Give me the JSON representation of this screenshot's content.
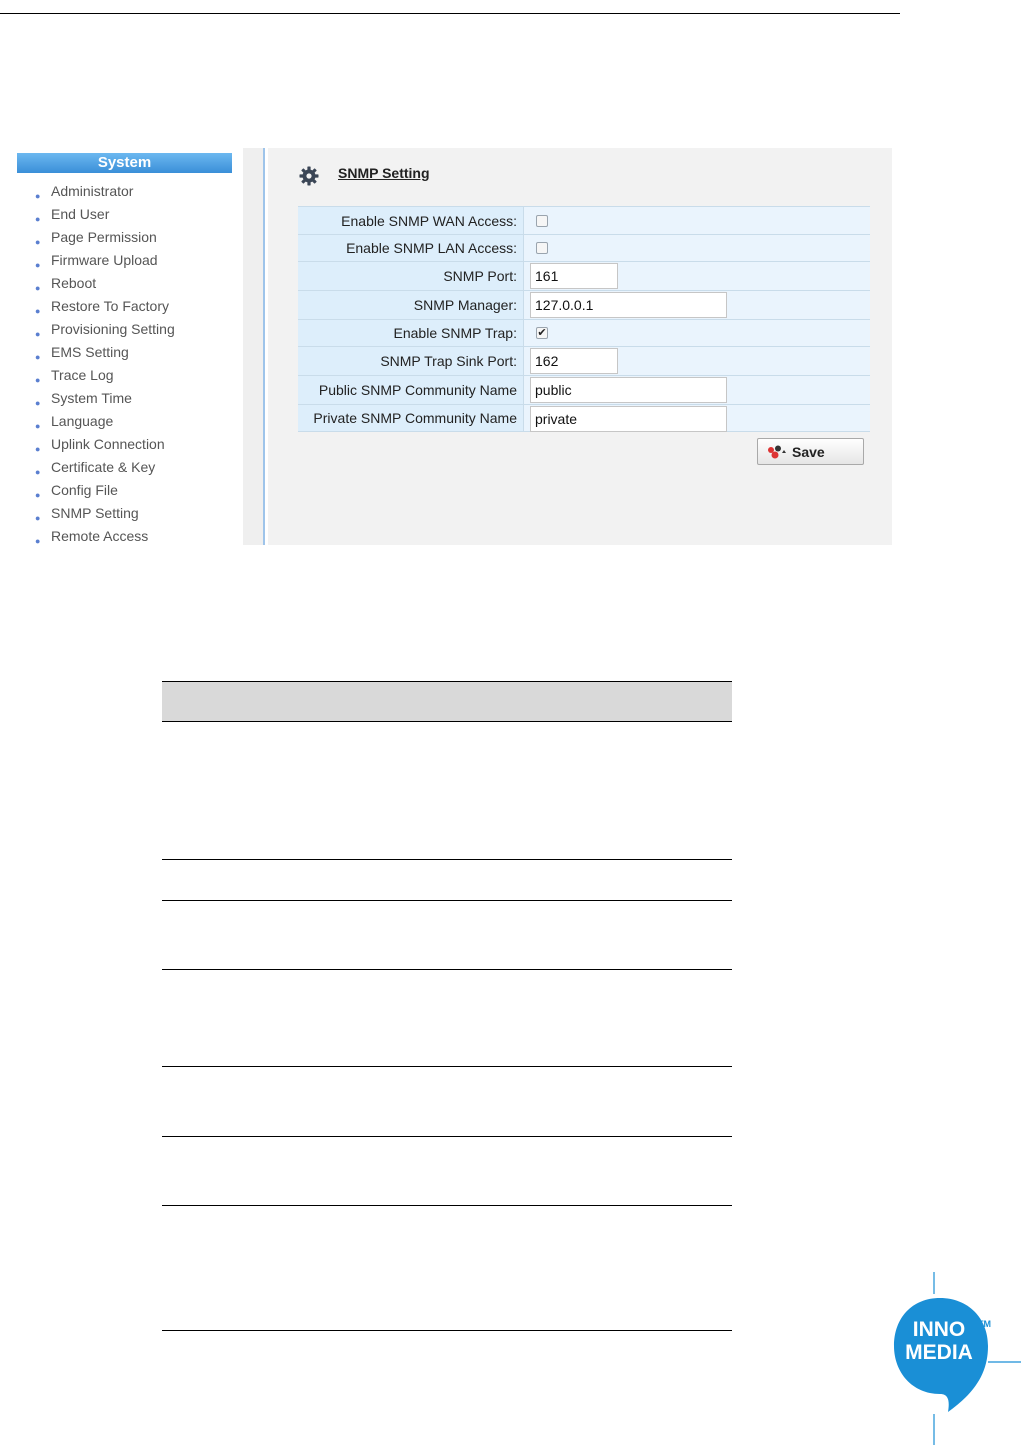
{
  "sidebar": {
    "header": "System",
    "items": [
      {
        "label": "Administrator"
      },
      {
        "label": "End User"
      },
      {
        "label": "Page Permission"
      },
      {
        "label": "Firmware Upload"
      },
      {
        "label": "Reboot"
      },
      {
        "label": "Restore To Factory"
      },
      {
        "label": "Provisioning Setting"
      },
      {
        "label": "EMS Setting"
      },
      {
        "label": "Trace Log"
      },
      {
        "label": "System Time"
      },
      {
        "label": "Language"
      },
      {
        "label": "Uplink Connection"
      },
      {
        "label": "Certificate & Key"
      },
      {
        "label": "Config File"
      },
      {
        "label": "SNMP Setting"
      },
      {
        "label": "Remote Access"
      }
    ]
  },
  "page": {
    "title": "SNMP Setting",
    "icon": "gear-icon"
  },
  "form": {
    "wan_access_label": "Enable SNMP WAN Access:",
    "wan_access_checked": false,
    "lan_access_label": "Enable SNMP LAN Access:",
    "lan_access_checked": false,
    "port_label": "SNMP Port:",
    "port_value": "161",
    "manager_label": "SNMP Manager:",
    "manager_value": "127.0.0.1",
    "trap_label": "Enable SNMP Trap:",
    "trap_checked": true,
    "trap_sink_port_label": "SNMP Trap Sink Port:",
    "trap_sink_port_value": "162",
    "public_community_label": "Public SNMP Community Name",
    "public_community_value": "public",
    "private_community_label": "Private SNMP Community Name",
    "private_community_value": "private"
  },
  "actions": {
    "save_label": "Save",
    "save_icon": "people-icon"
  },
  "colors": {
    "sidebar_header": "#3a8fd8",
    "row_bg": "#ddeefb",
    "logo_blue": "#1a8fd6"
  },
  "logo": {
    "line1": "INNO",
    "line2": "MEDIA",
    "tm": "TM"
  }
}
